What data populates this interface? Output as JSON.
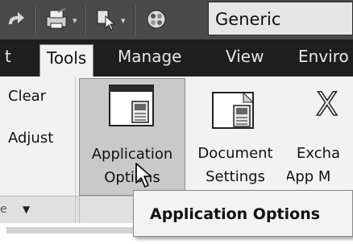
{
  "quick_access": {
    "icons": [
      "redo-icon",
      "print-icon",
      "select-icon",
      "appearance-icon"
    ],
    "dropdown_glyph": "▾",
    "appearance_value": "Generic"
  },
  "tabs": [
    {
      "label": "t",
      "active": false
    },
    {
      "label": "Tools",
      "active": true
    },
    {
      "label": "Manage",
      "active": false
    },
    {
      "label": "View",
      "active": false
    },
    {
      "label": "Enviro",
      "active": false
    }
  ],
  "ribbon": {
    "small_commands": [
      "Clear",
      "Adjust"
    ],
    "buttons": [
      {
        "line1": "Application",
        "line2": "Options",
        "icon": "application-options-icon",
        "pressed": true
      },
      {
        "line1": "Document",
        "line2": "Settings",
        "icon": "document-settings-icon",
        "pressed": false
      },
      {
        "line1": "Excha",
        "line2": "App M",
        "icon": "exchange-app-manager-icon",
        "pressed": false
      }
    ],
    "panel_caret": "▼",
    "panel_ghost": "e"
  },
  "tooltip": {
    "text": "Application Options"
  },
  "colors": {
    "toolbar_bg": "#4a4a4a",
    "tabs_bg": "#1e1e1e",
    "ribbon_bg": "#f2f2f2",
    "pressed_bg": "#c9c9c9"
  }
}
